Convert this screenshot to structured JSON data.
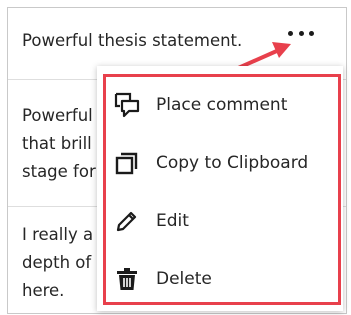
{
  "comments": [
    {
      "lines": [
        "Powerful thesis statement."
      ]
    },
    {
      "lines": [
        "Powerful",
        "that brill",
        "stage for"
      ]
    },
    {
      "lines": [
        "I really a",
        "depth of",
        "here."
      ]
    }
  ],
  "menu": {
    "items": [
      {
        "label": "Place comment",
        "icon": "comment-icon"
      },
      {
        "label": "Copy to Clipboard",
        "icon": "copy-icon"
      },
      {
        "label": "Edit",
        "icon": "pencil-icon"
      },
      {
        "label": "Delete",
        "icon": "trash-icon"
      }
    ]
  },
  "colors": {
    "highlight": "#e8404c",
    "text": "#262626",
    "border": "#c9c9c9"
  }
}
